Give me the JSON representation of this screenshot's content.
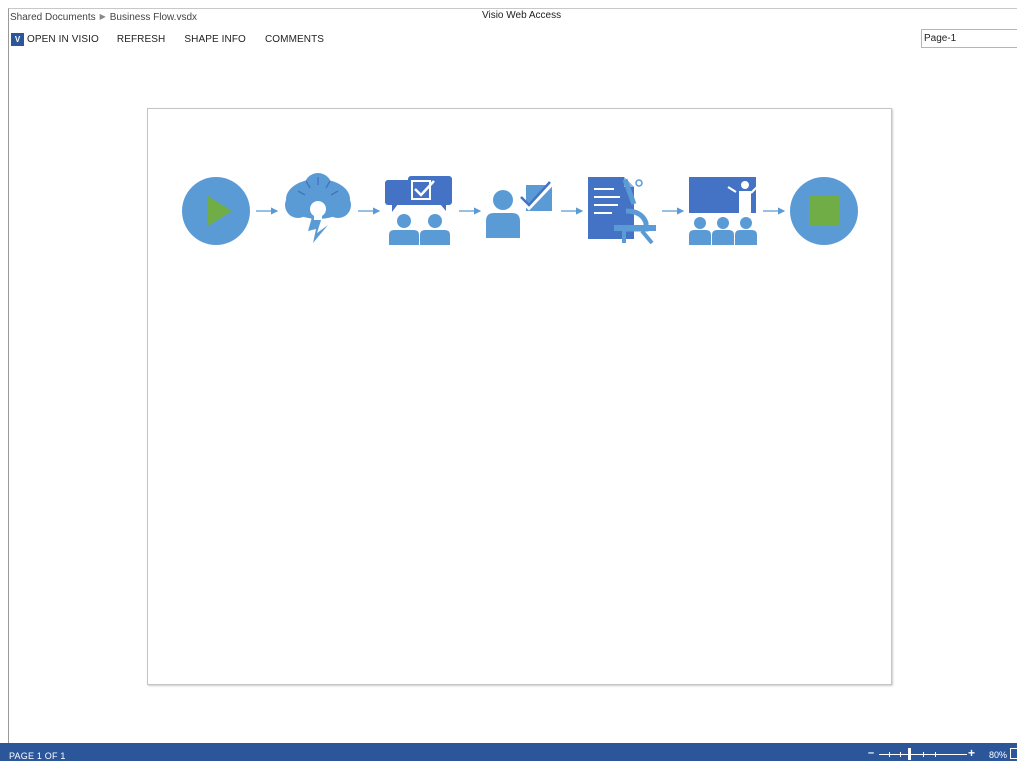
{
  "breadcrumb": {
    "folder": "Shared Documents",
    "file": "Business Flow.vsdx"
  },
  "app_title": "Visio Web Access",
  "toolbar": {
    "logo_text": "V",
    "open_in_visio": "OPEN IN VISIO",
    "refresh": "REFRESH",
    "shape_info": "SHAPE INFO",
    "comments": "COMMENTS"
  },
  "page_selector": {
    "selected": "Page-1"
  },
  "diagram": {
    "shapes": [
      {
        "name": "start",
        "icon": "play-icon"
      },
      {
        "name": "brainstorm",
        "icon": "idea-cloud-icon"
      },
      {
        "name": "discussion",
        "icon": "people-chat-icon"
      },
      {
        "name": "approval",
        "icon": "person-check-icon"
      },
      {
        "name": "research",
        "icon": "document-microscope-icon"
      },
      {
        "name": "presentation",
        "icon": "presentation-icon"
      },
      {
        "name": "end",
        "icon": "stop-icon"
      }
    ],
    "colors": {
      "blue": "#5b9bd5",
      "dark_blue": "#4472c4",
      "green": "#70ad47"
    }
  },
  "statusbar": {
    "page_info": "PAGE 1 OF 1",
    "zoom_level": "80%",
    "color": "#2b579a"
  }
}
